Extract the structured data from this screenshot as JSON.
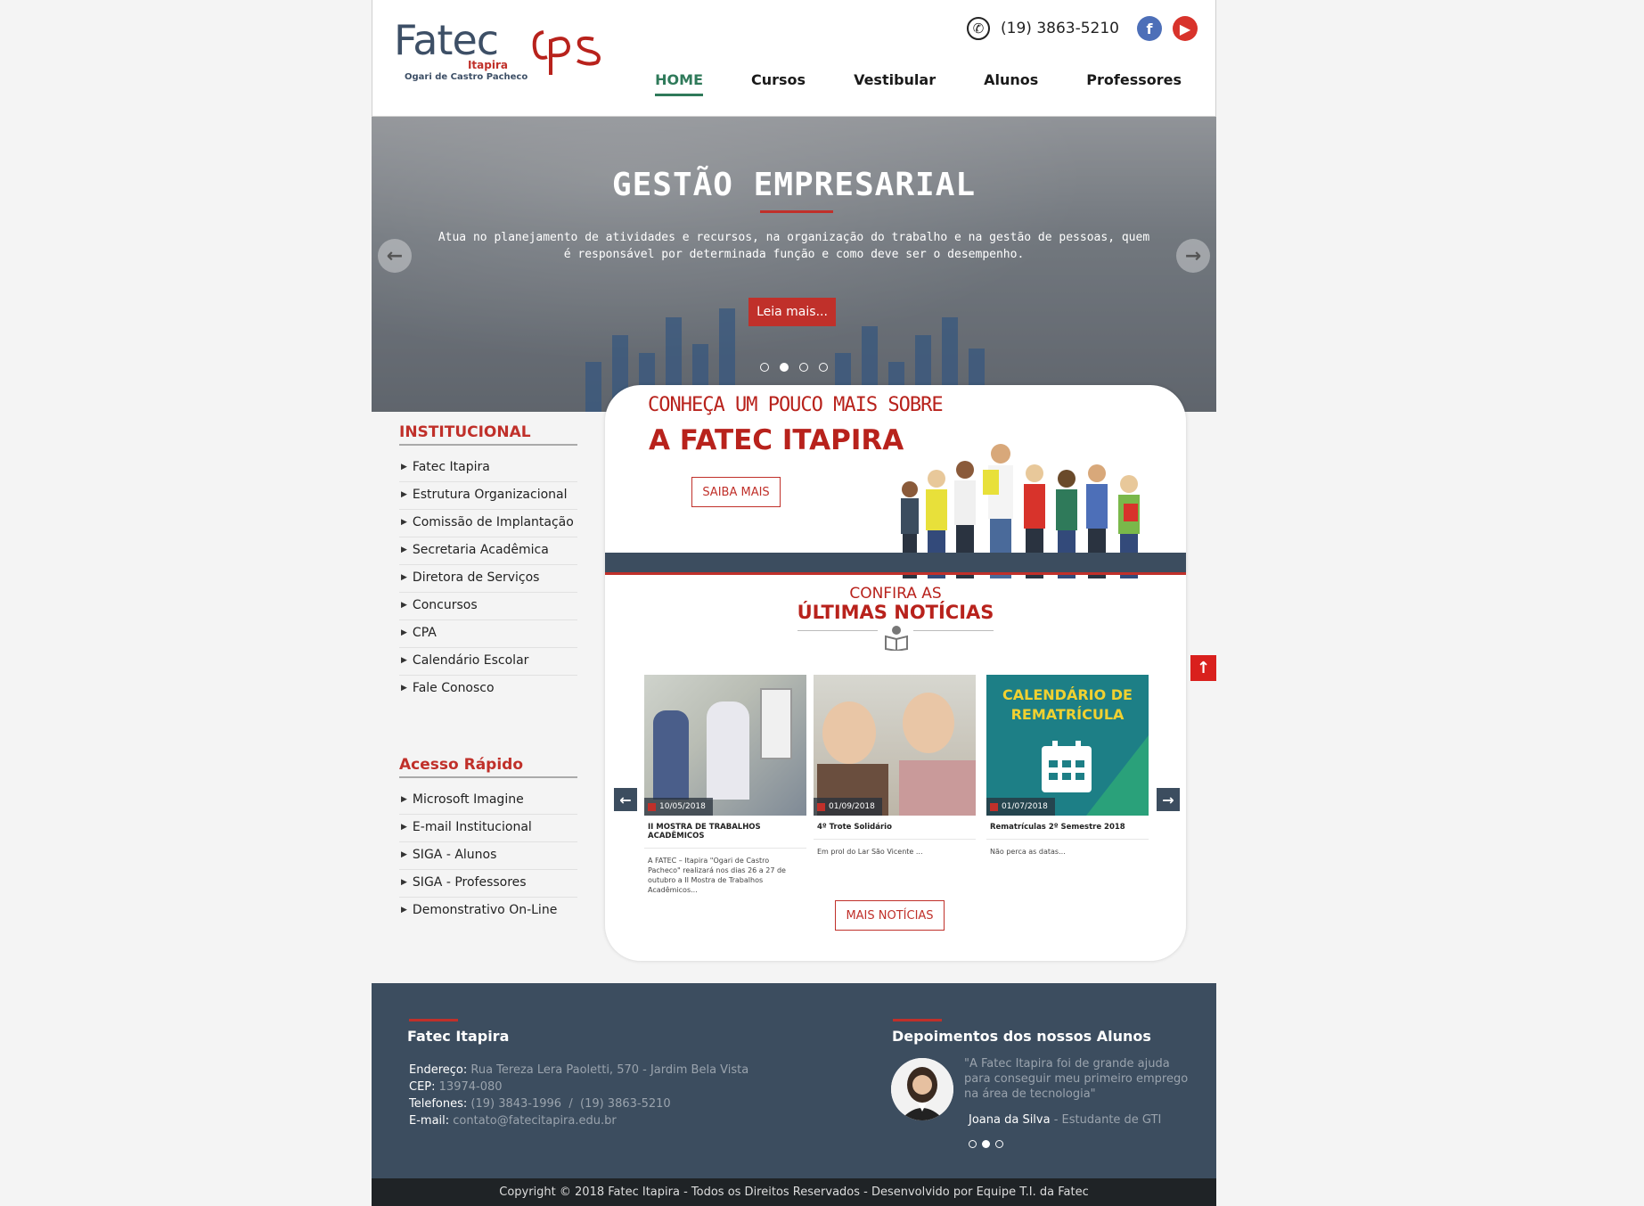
{
  "header": {
    "logo_fatec": "Fatec",
    "logo_city": "Itapira",
    "logo_sub": "Ogari de Castro Pacheco",
    "logo_cps": "cps",
    "phone": "(19) 3863-5210",
    "nav": [
      {
        "label": "HOME",
        "active": true
      },
      {
        "label": "Cursos"
      },
      {
        "label": "Vestibular"
      },
      {
        "label": "Alunos"
      },
      {
        "label": "Professores"
      }
    ]
  },
  "hero": {
    "title": "GESTÃO EMPRESARIAL",
    "text": "Atua no planejamento de atividades e recursos, na organização do trabalho e na gestão de pessoas, quem é responsável por determinada função e como deve ser o desempenho.",
    "button": "Leia mais...",
    "slides_total": 4,
    "slide_active": 2
  },
  "sidebar": {
    "institucional_title": "INSTITUCIONAL",
    "institucional": [
      "Fatec Itapira",
      "Estrutura Organizacional",
      "Comissão de Implantação",
      "Secretaria Acadêmica",
      "Diretora de Serviços",
      "Concursos",
      "CPA",
      "Calendário Escolar",
      "Fale Conosco"
    ],
    "acesso_title": "Acesso Rápido",
    "acesso": [
      "Microsoft Imagine",
      "E-mail Institucional",
      "SIGA - Alunos",
      "SIGA - Professores",
      "Demonstrativo On-Line"
    ]
  },
  "about": {
    "line1": "CONHEÇA UM POUCO MAIS SOBRE",
    "line2": "A FATEC ITAPIRA",
    "button": "SAIBA MAIS"
  },
  "news": {
    "line1": "CONFIRA AS",
    "line2": "ÚLTIMAS NOTÍCIAS",
    "items": [
      {
        "date": "10/05/2018",
        "title": "II MOSTRA DE TRABALHOS ACADÊMICOS",
        "text": "A FATEC – Itapira \"Ogari de Castro Pacheco\" realizará nos dias 26 a 27 de outubro a II Mostra de Trabalhos Acadêmicos..."
      },
      {
        "date": "01/09/2018",
        "title": "4º Trote Solidário",
        "text": "Em prol do Lar São Vicente ..."
      },
      {
        "date": "01/07/2018",
        "title": "Rematrículas 2º Semestre 2018",
        "text": "Não perca as datas...",
        "banner": "CALENDÁRIO DE REMATRÍCULA"
      }
    ],
    "more_button": "MAIS NOTÍCIAS"
  },
  "footer": {
    "left_title": "Fatec Itapira",
    "address_label": "Endereço:",
    "address": "Rua Tereza Lera Paoletti, 570 - Jardim Bela Vista",
    "cep_label": "CEP:",
    "cep": "13974-080",
    "phones_label": "Telefones:",
    "phones": "(19) 3843-1996  /  (19) 3863-5210",
    "email_label": "E-mail:",
    "email": "contato@fatecitapira.edu.br",
    "right_title": "Depoimentos dos nossos Alunos",
    "quote": "\"A Fatec Itapira foi de grande ajuda para conseguir meu primeiro emprego na área de tecnologia\"",
    "author": "Joana da Silva",
    "author_role": "- Estudante de GTI",
    "copyright": "Copyright © 2018 Fatec Itapira - Todos os Direitos Reservados - Desenvolvido por Equipe T.I. da Fatec"
  },
  "colors": {
    "accent_red": "#c0302a",
    "footer_bg": "#3c4d5f",
    "nav_active": "#2f7a5a"
  }
}
